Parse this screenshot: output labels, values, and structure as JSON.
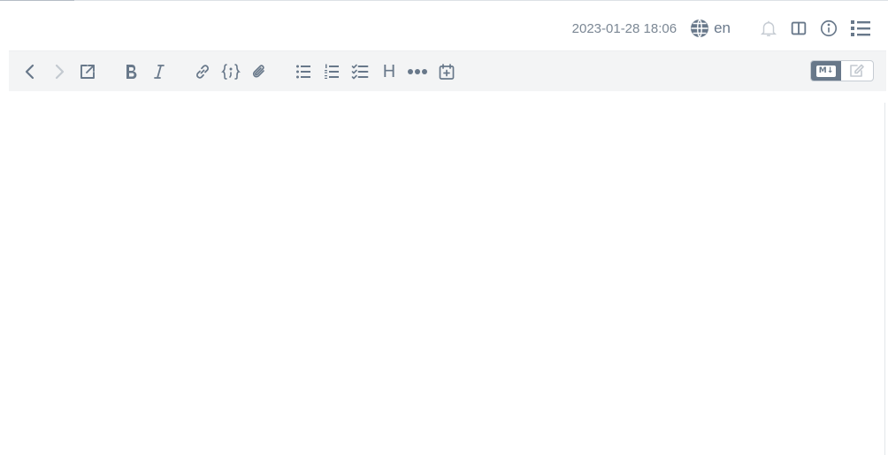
{
  "status_bar": {
    "datetime": "2023-01-28 18:06",
    "language": "en",
    "icons": [
      "globe-icon",
      "bell-icon",
      "split-view-icon",
      "info-icon",
      "outline-icon"
    ]
  },
  "toolbar": {
    "buttons": [
      "back-icon",
      "forward-icon",
      "open-external-icon",
      "bold-icon",
      "italic-icon",
      "link-icon",
      "code-icon",
      "attachment-icon",
      "bullet-list-icon",
      "numbered-list-icon",
      "checklist-icon",
      "heading-icon",
      "more-icon",
      "insert-date-icon"
    ],
    "heading_glyph": "H",
    "mode_toggle": {
      "markdown_label": "M↓",
      "active": "markdown"
    }
  },
  "editor": {
    "content": ""
  },
  "colors": {
    "icon": "#68788a",
    "icon_disabled": "#c3c9d0",
    "toolbar_bg": "#f3f4f5"
  }
}
